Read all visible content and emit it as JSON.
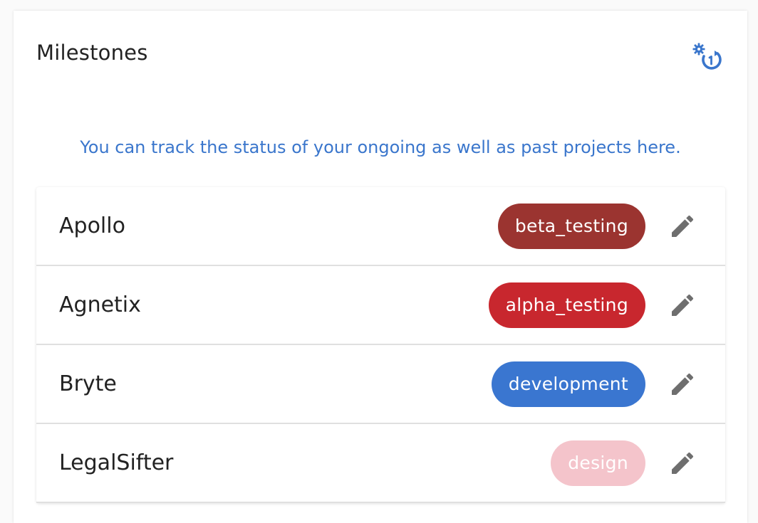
{
  "card": {
    "title": "Milestones",
    "action_icon": "settings-refresh-icon",
    "subtitle": "You can track the status of your ongoing as well as past projects here."
  },
  "colors": {
    "accent": "#3a76cc",
    "edit_icon": "#6e6e6e"
  },
  "projects": [
    {
      "name": "Apollo",
      "status": "beta_testing",
      "badge_color": "#9b3430",
      "badge_text_color": "#ffffff",
      "edit_icon": "pencil-icon"
    },
    {
      "name": "Agnetix",
      "status": "alpha_testing",
      "badge_color": "#c8272e",
      "badge_text_color": "#ffffff",
      "edit_icon": "pencil-icon"
    },
    {
      "name": "Bryte",
      "status": "development",
      "badge_color": "#3a76d0",
      "badge_text_color": "#ffffff",
      "edit_icon": "pencil-icon"
    },
    {
      "name": "LegalSifter",
      "status": "design",
      "badge_color": "#f4c4cb",
      "badge_text_color": "#ffffff",
      "edit_icon": "pencil-icon"
    }
  ]
}
